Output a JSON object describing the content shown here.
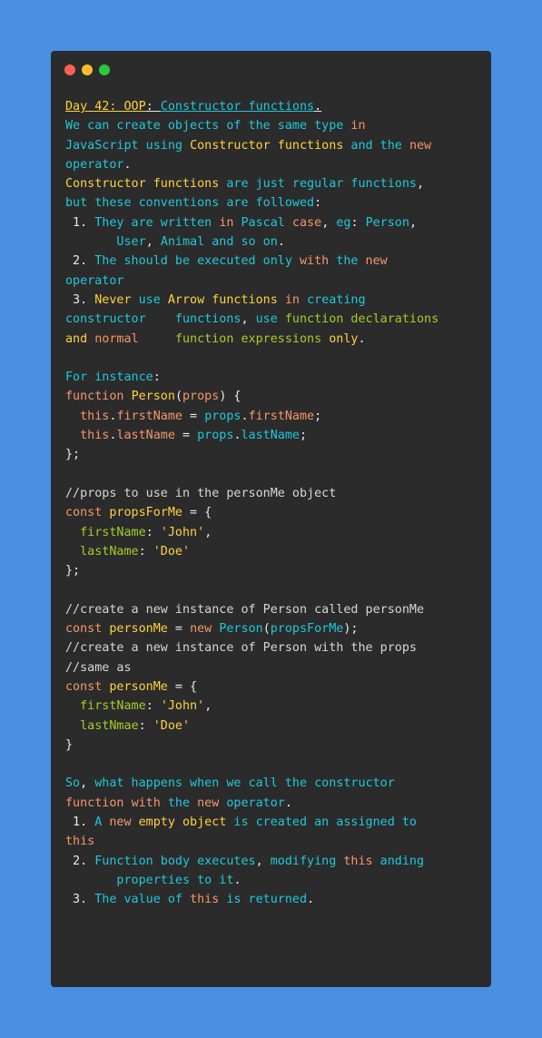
{
  "window": {
    "controls": [
      {
        "name": "close",
        "color": "#ff5f56"
      },
      {
        "name": "minimize",
        "color": "#ffbd2e"
      },
      {
        "name": "maximize",
        "color": "#27c93f"
      }
    ]
  },
  "lines": [
    [
      [
        "Day 42: OOP",
        "yellow ul"
      ],
      [
        ": ",
        "white ul"
      ],
      [
        "Constructor functions",
        "cyan ul"
      ],
      [
        ".",
        "white ul"
      ]
    ],
    [
      [
        "We can create objects of the same type ",
        "cyan"
      ],
      [
        "in",
        "orange"
      ]
    ],
    [
      [
        "JavaScript using ",
        "cyan"
      ],
      [
        "Constructor functions",
        "yellow"
      ],
      [
        " and the ",
        "cyan"
      ],
      [
        "new",
        "orange"
      ]
    ],
    [
      [
        "operator",
        "cyan"
      ],
      [
        ".",
        "white"
      ]
    ],
    [
      [
        "Constructor functions",
        "yellow"
      ],
      [
        " are just regular functions",
        "cyan"
      ],
      [
        ",",
        "white"
      ]
    ],
    [
      [
        "but these conventions are followed",
        "cyan"
      ],
      [
        ":",
        "white"
      ]
    ],
    [
      [
        " 1. ",
        "white"
      ],
      [
        "They are written ",
        "cyan"
      ],
      [
        "in",
        "orange"
      ],
      [
        " Pascal ",
        "cyan"
      ],
      [
        "case",
        "orange"
      ],
      [
        ", ",
        "white"
      ],
      [
        "eg",
        "cyan"
      ],
      [
        ": ",
        "white"
      ],
      [
        "Person",
        "cyan"
      ],
      [
        ",",
        "white"
      ]
    ],
    [
      [
        "       User",
        "cyan"
      ],
      [
        ", ",
        "white"
      ],
      [
        "Animal and so on",
        "cyan"
      ],
      [
        ".",
        "white"
      ]
    ],
    [
      [
        " 2. ",
        "white"
      ],
      [
        "The should be executed only ",
        "cyan"
      ],
      [
        "with",
        "orange"
      ],
      [
        " the ",
        "cyan"
      ],
      [
        "new",
        "orange"
      ]
    ],
    [
      [
        "operator",
        "cyan"
      ]
    ],
    [
      [
        " 3. ",
        "white"
      ],
      [
        "Never",
        "yellow"
      ],
      [
        " use ",
        "cyan"
      ],
      [
        "Arrow functions",
        "yellow"
      ],
      [
        " in",
        "orange"
      ],
      [
        " creating",
        "cyan"
      ]
    ],
    [
      [
        "constructor    functions",
        "cyan"
      ],
      [
        ", ",
        "white"
      ],
      [
        "use ",
        "cyan"
      ],
      [
        "function declarations",
        "green"
      ]
    ],
    [
      [
        "and",
        "yellow"
      ],
      [
        " normal     ",
        "orange"
      ],
      [
        "function expressions ",
        "green"
      ],
      [
        "only",
        "yellow"
      ],
      [
        ".",
        "white"
      ]
    ],
    [],
    [
      [
        "For instance",
        "cyan"
      ],
      [
        ":",
        "white"
      ]
    ],
    [
      [
        "function ",
        "orange"
      ],
      [
        "Person",
        "yellow"
      ],
      [
        "(",
        "white"
      ],
      [
        "props",
        "orange"
      ],
      [
        ") {",
        "white"
      ]
    ],
    [
      [
        "  this",
        "orange"
      ],
      [
        ".",
        "white"
      ],
      [
        "firstName",
        "orange"
      ],
      [
        " = ",
        "white"
      ],
      [
        "props",
        "cyan"
      ],
      [
        ".",
        "white"
      ],
      [
        "firstName",
        "orange"
      ],
      [
        ";",
        "white"
      ]
    ],
    [
      [
        "  this",
        "orange"
      ],
      [
        ".",
        "white"
      ],
      [
        "lastName",
        "orange"
      ],
      [
        " = ",
        "white"
      ],
      [
        "props",
        "cyan"
      ],
      [
        ".",
        "white"
      ],
      [
        "lastName",
        "cyan"
      ],
      [
        ";",
        "white"
      ]
    ],
    [
      [
        "};",
        "white"
      ]
    ],
    [],
    [
      [
        "//props to use in the personMe object",
        "gray"
      ]
    ],
    [
      [
        "const ",
        "orange"
      ],
      [
        "propsForMe",
        "yellow"
      ],
      [
        " = {",
        "white"
      ]
    ],
    [
      [
        "  firstName",
        "green"
      ],
      [
        ": ",
        "white"
      ],
      [
        "'John'",
        "yellow"
      ],
      [
        ",",
        "white"
      ]
    ],
    [
      [
        "  lastName",
        "green"
      ],
      [
        ": ",
        "white"
      ],
      [
        "'Doe'",
        "yellow"
      ]
    ],
    [
      [
        "};",
        "white"
      ]
    ],
    [],
    [
      [
        "//create a new instance of Person called personMe",
        "gray"
      ]
    ],
    [
      [
        "const ",
        "orange"
      ],
      [
        "personMe",
        "yellow"
      ],
      [
        " = ",
        "white"
      ],
      [
        "new ",
        "orange"
      ],
      [
        "Person",
        "cyan"
      ],
      [
        "(",
        "white"
      ],
      [
        "propsForMe",
        "cyan"
      ],
      [
        ");",
        "white"
      ]
    ],
    [
      [
        "//create a new instance of Person with the props",
        "gray"
      ]
    ],
    [
      [
        "//same as",
        "gray"
      ]
    ],
    [
      [
        "const ",
        "orange"
      ],
      [
        "personMe",
        "yellow"
      ],
      [
        " = {",
        "white"
      ]
    ],
    [
      [
        "  firstName",
        "green"
      ],
      [
        ": ",
        "white"
      ],
      [
        "'John'",
        "yellow"
      ],
      [
        ",",
        "white"
      ]
    ],
    [
      [
        "  lastNmae",
        "green"
      ],
      [
        ": ",
        "white"
      ],
      [
        "'Doe'",
        "yellow"
      ]
    ],
    [
      [
        "}",
        "white"
      ]
    ],
    [],
    [
      [
        "So",
        "cyan"
      ],
      [
        ", ",
        "white"
      ],
      [
        "what happens when we call the constructor",
        "cyan"
      ]
    ],
    [
      [
        "function ",
        "orange"
      ],
      [
        "with",
        "orange"
      ],
      [
        " the ",
        "cyan"
      ],
      [
        "new",
        "orange"
      ],
      [
        " operator",
        "cyan"
      ],
      [
        ".",
        "white"
      ]
    ],
    [
      [
        " 1. ",
        "white"
      ],
      [
        "A ",
        "cyan"
      ],
      [
        "new",
        "orange"
      ],
      [
        " empty object",
        "yellow"
      ],
      [
        " is created an assigned to",
        "cyan"
      ]
    ],
    [
      [
        "this",
        "orange"
      ]
    ],
    [
      [
        " 2. ",
        "white"
      ],
      [
        "Function body executes",
        "cyan"
      ],
      [
        ", ",
        "white"
      ],
      [
        "modifying ",
        "cyan"
      ],
      [
        "this",
        "orange"
      ],
      [
        " anding",
        "cyan"
      ]
    ],
    [
      [
        "       properties to it",
        "cyan"
      ],
      [
        ".",
        "white"
      ]
    ],
    [
      [
        " 3. ",
        "white"
      ],
      [
        "The value of ",
        "cyan"
      ],
      [
        "this",
        "orange"
      ],
      [
        " is returned",
        "cyan"
      ],
      [
        ".",
        "white"
      ]
    ]
  ]
}
